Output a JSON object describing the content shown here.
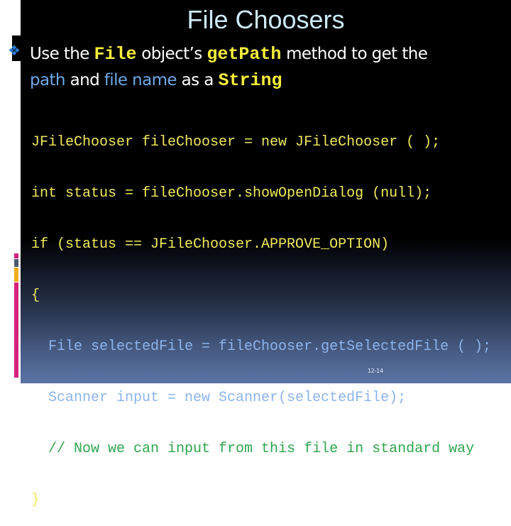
{
  "slide": {
    "title": "File Choosers",
    "bullet": {
      "icon": "four-diamond-bullet-icon",
      "segments": [
        {
          "text": "Use the ",
          "style": "normal"
        },
        {
          "text": "File",
          "style": "code"
        },
        {
          "text": " object’s ",
          "style": "normal"
        },
        {
          "text": "getPath",
          "style": "code"
        },
        {
          "text": " method to get the ",
          "style": "normal"
        },
        {
          "text": "path",
          "style": "highlight"
        },
        {
          "text": " and ",
          "style": "normal"
        },
        {
          "text": "file name",
          "style": "highlight"
        },
        {
          "text": " as a ",
          "style": "normal"
        },
        {
          "text": "String",
          "style": "code"
        }
      ]
    },
    "code_lines": [
      {
        "text": "JFileChooser fileChooser = new JFileChooser ( );",
        "color": "yellow"
      },
      {
        "text": "int status = fileChooser.showOpenDialog (null);",
        "color": "yellow"
      },
      {
        "text": "if (status == JFileChooser.APPROVE_OPTION)",
        "color": "yellow"
      },
      {
        "text": "{",
        "color": "yellow"
      },
      {
        "text": "  File selectedFile = fileChooser.getSelectedFile ( );",
        "color": "blue"
      },
      {
        "text": "  Scanner input = new Scanner(selectedFile);",
        "color": "blue"
      },
      {
        "text": "  // Now we can input from this file in standard way",
        "color": "green"
      },
      {
        "text": "}",
        "color": "yellow"
      }
    ],
    "page_number": "12-14"
  },
  "colors": {
    "title": "#cdeaf8",
    "code_keyword": "#f7ee3c",
    "highlight": "#6fa8e8",
    "bullet": "#2a7fd9",
    "code_yellow": "#f0ea5c",
    "code_blue": "#8cb4ec",
    "code_green": "#2fa64e",
    "accent_magenta": "#d4217c",
    "accent_gray": "#4d5970",
    "accent_orange": "#f0ac1c"
  }
}
